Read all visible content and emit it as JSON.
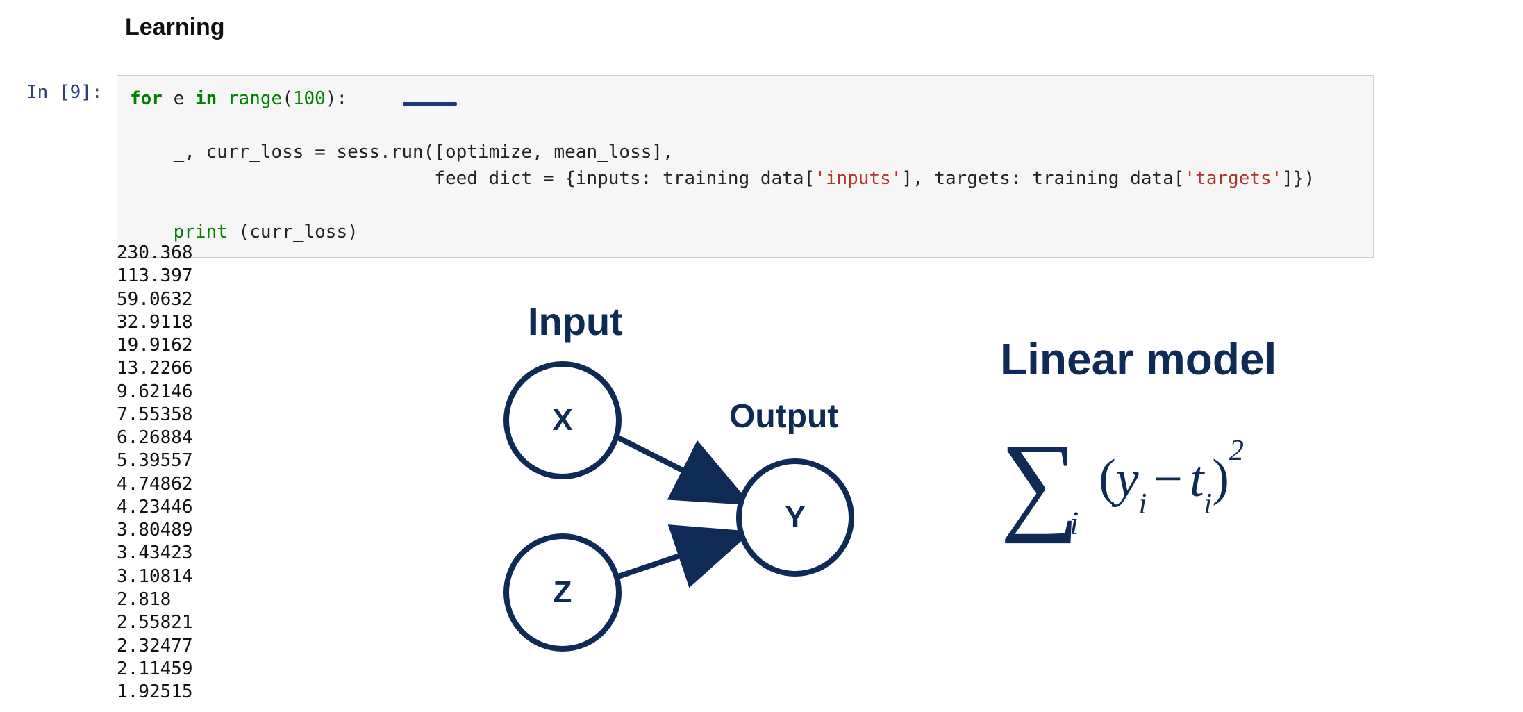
{
  "heading": "Learning",
  "cell": {
    "prompt": "In [9]:",
    "code": {
      "kw_for": "for",
      "var_e": " e ",
      "kw_in": "in",
      "sp1": " ",
      "fn_range": "range",
      "open_paren": "(",
      "num_100": "100",
      "close_paren_colon": "):",
      "newline1": "\n",
      "newline_blank": "\n",
      "indent1": "    ",
      "line2a": "_, curr_loss = sess.run([optimize, mean_loss],",
      "newline2": "\n",
      "indent2": "                            feed_dict = {inputs: training_data[",
      "str_inputs": "'inputs'",
      "mid2": "], targets: training_data[",
      "str_targets": "'targets'",
      "end2": "]})",
      "newline3": "\n",
      "newline3b": "\n",
      "indent3": "    ",
      "fn_print": "print",
      "print_rest": " (curr_loss)"
    }
  },
  "losses": [
    "230.368",
    "113.397",
    "59.0632",
    "32.9118",
    "19.9162",
    "13.2266",
    "9.62146",
    "7.55358",
    "6.26884",
    "5.39557",
    "4.74862",
    "4.23446",
    "3.80489",
    "3.43423",
    "3.10814",
    "2.818",
    "2.55821",
    "2.32477",
    "2.11459",
    "1.92515"
  ],
  "diagram": {
    "label_input": "Input",
    "label_output": "Output",
    "node_x": "X",
    "node_z": "Z",
    "node_y": "Y"
  },
  "math": {
    "title": "Linear model",
    "sigma": "∑",
    "sigma_sub": "i",
    "paren_open": "(",
    "y": "y",
    "y_sub": "i",
    "minus": "−",
    "t": "t",
    "t_sub": "i",
    "paren_close": ")",
    "square": "2"
  }
}
